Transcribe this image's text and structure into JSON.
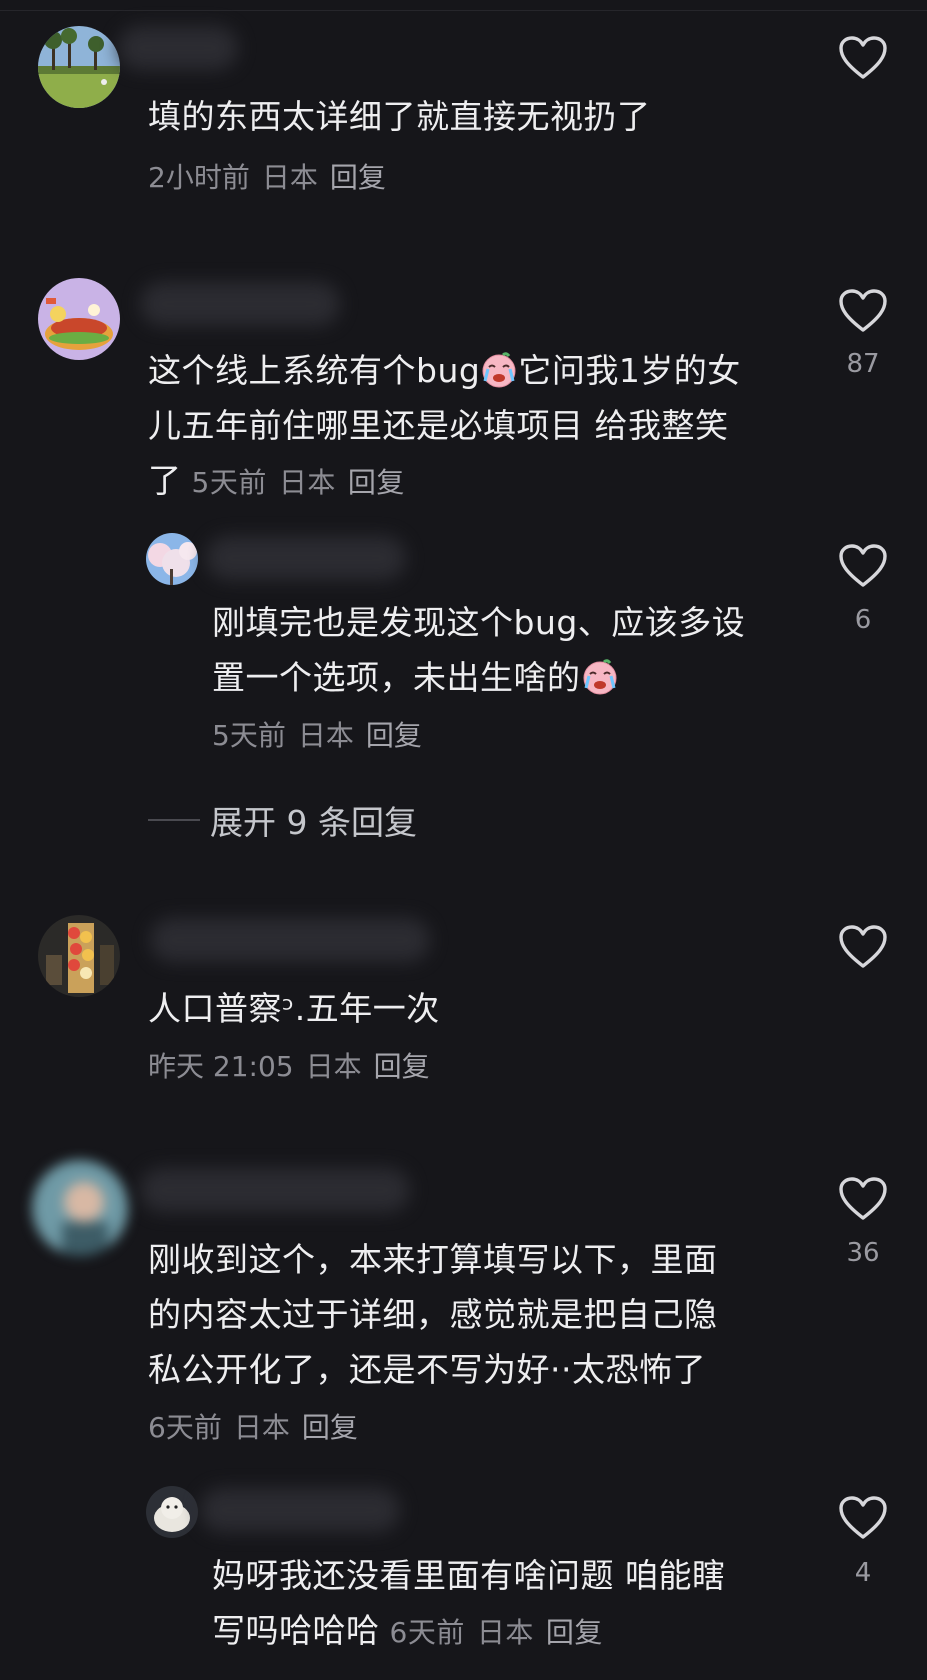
{
  "comments": [
    {
      "text": "填的东西太详细了就直接无视扔了",
      "time": "2小时前",
      "region": "日本",
      "reply_label": "回复",
      "likes": "",
      "icons": [
        "avatar-park",
        "heart-outline-icon"
      ]
    },
    {
      "text_line1_a": "这个线上系统有个bug",
      "text_line1_b": "它问我1岁的女",
      "text_line2": "儿五年前住哪里还是必填项目 给我整笑",
      "text_line3": "了",
      "time": "5天前",
      "region": "日本",
      "reply_label": "回复",
      "likes": "87",
      "replies": [
        {
          "text_line1": "刚填完也是发现这个bug、应该多设",
          "text_line2": "置一个选项，未出生啥的",
          "time": "5天前",
          "region": "日本",
          "reply_label": "回复",
          "likes": "6"
        }
      ],
      "expand_label": "展开 9 条回复"
    },
    {
      "text": "人口普察ᵓ.五年一次",
      "time": "昨天 21:05",
      "region": "日本",
      "reply_label": "回复",
      "likes": ""
    },
    {
      "text_line1": "刚收到这个，本来打算填写以下，里面",
      "text_line2": "的内容太过于详细，感觉就是把自己隐",
      "text_line3": "私公开化了，还是不写为好··太恐怖了",
      "time": "6天前",
      "region": "日本",
      "reply_label": "回复",
      "likes": "36",
      "replies": [
        {
          "text_line1": "妈呀我还没看里面有啥问题 咱能瞎",
          "text_line2": "写吗哈哈哈",
          "time": "6天前",
          "region": "日本",
          "reply_label": "回复",
          "likes": "4"
        }
      ]
    }
  ],
  "colors": {
    "background": "#16161a",
    "text": "#eeeef0",
    "meta": "#8c8c93",
    "heart": "#d7d7db"
  }
}
